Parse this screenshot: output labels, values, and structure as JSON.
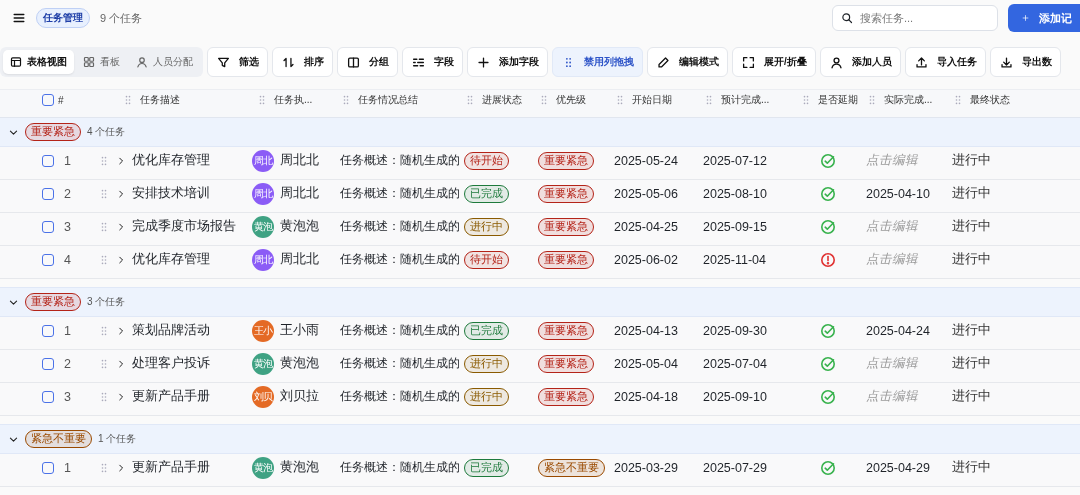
{
  "header": {
    "title_tag": "任务管理",
    "count": "9 个任务",
    "search": {
      "placeholder": "搜索任务..."
    },
    "add_button": "添加记"
  },
  "view_tabs": [
    {
      "label": "表格视图",
      "kind": "table",
      "selected": true
    },
    {
      "label": "看板",
      "kind": "grid",
      "selected": false
    },
    {
      "label": "人员分配",
      "kind": "user",
      "selected": false
    }
  ],
  "toolbar": [
    {
      "label": "筛选",
      "kind": "filter",
      "active": false
    },
    {
      "label": "排序",
      "kind": "sort",
      "active": false
    },
    {
      "label": "分组",
      "kind": "columns",
      "active": false
    },
    {
      "label": "字段",
      "kind": "fields",
      "active": false
    },
    {
      "label": "添加字段",
      "kind": "plus",
      "active": false
    },
    {
      "label": "禁用列拖拽",
      "kind": "grip",
      "active": true
    },
    {
      "label": "编辑模式",
      "kind": "pencil",
      "active": false
    },
    {
      "label": "展开/折叠",
      "kind": "expand",
      "active": false
    },
    {
      "label": "添加人员",
      "kind": "user",
      "active": false
    },
    {
      "label": "导入任务",
      "kind": "upload",
      "active": false
    },
    {
      "label": "导出数",
      "kind": "download",
      "active": false
    }
  ],
  "table": {
    "select_all": {
      "checked": false
    },
    "columns": [
      "#",
      "任务描述",
      "任务执...",
      "任务情况总结",
      "进展状态",
      "优先级",
      "开始日期",
      "预计完成...",
      "是否延期",
      "实际完成...",
      "最终状态"
    ],
    "groups": [
      {
        "tag": {
          "text": "重要紧急",
          "color": "#b42318"
        },
        "count": "4 个任务",
        "expanded": true,
        "rows": [
          {
            "checked": false,
            "number": "1",
            "title": "优化库存管理",
            "expanded": false,
            "assignee": {
              "initials": "周北",
              "name": "周北北",
              "color": "#8b5cf6"
            },
            "summary": "任务概述：随机生成的",
            "status": {
              "text": "待开始",
              "color": "#b42318"
            },
            "priority": {
              "text": "重要紧急",
              "color": "#b42318"
            },
            "start": "2025-05-24",
            "planned": "2025-07-12",
            "delayed": false,
            "actual": {
              "text": "点击编辑",
              "kind": "placeholder"
            },
            "final": "进行中"
          },
          {
            "checked": false,
            "number": "2",
            "title": "安排技术培训",
            "expanded": false,
            "assignee": {
              "initials": "周北",
              "name": "周北北",
              "color": "#8b5cf6"
            },
            "summary": "任务概述：随机生成的",
            "status": {
              "text": "已完成",
              "color": "#1e7a3c"
            },
            "priority": {
              "text": "重要紧急",
              "color": "#b42318"
            },
            "start": "2025-05-06",
            "planned": "2025-08-10",
            "delayed": false,
            "actual": {
              "text": "2025-04-10",
              "kind": "date"
            },
            "final": "进行中"
          },
          {
            "checked": false,
            "number": "3",
            "title": "完成季度市场报告",
            "expanded": false,
            "assignee": {
              "initials": "黄泡",
              "name": "黄泡泡",
              "color": "#3fa283"
            },
            "summary": "任务概述：随机生成的",
            "status": {
              "text": "进行中",
              "color": "#8a5a00"
            },
            "priority": {
              "text": "重要紧急",
              "color": "#b42318"
            },
            "start": "2025-04-25",
            "planned": "2025-09-15",
            "delayed": false,
            "actual": {
              "text": "点击编辑",
              "kind": "placeholder"
            },
            "final": "进行中"
          },
          {
            "checked": false,
            "number": "4",
            "title": "优化库存管理",
            "expanded": false,
            "assignee": {
              "initials": "周北",
              "name": "周北北",
              "color": "#8b5cf6"
            },
            "summary": "任务概述：随机生成的",
            "status": {
              "text": "待开始",
              "color": "#b42318"
            },
            "priority": {
              "text": "重要紧急",
              "color": "#b42318"
            },
            "start": "2025-06-02",
            "planned": "2025-11-04",
            "delayed": true,
            "actual": {
              "text": "点击编辑",
              "kind": "placeholder"
            },
            "final": "进行中"
          }
        ]
      },
      {
        "tag": {
          "text": "重要紧急",
          "color": "#b42318"
        },
        "count": "3 个任务",
        "expanded": true,
        "rows": [
          {
            "checked": false,
            "number": "1",
            "title": "策划品牌活动",
            "expanded": false,
            "assignee": {
              "initials": "王小",
              "name": "王小雨",
              "color": "#e46a25"
            },
            "summary": "任务概述：随机生成的",
            "status": {
              "text": "已完成",
              "color": "#1e7a3c"
            },
            "priority": {
              "text": "重要紧急",
              "color": "#b42318"
            },
            "start": "2025-04-13",
            "planned": "2025-09-30",
            "delayed": false,
            "actual": {
              "text": "2025-04-24",
              "kind": "date"
            },
            "final": "进行中"
          },
          {
            "checked": false,
            "number": "2",
            "title": "处理客户投诉",
            "expanded": false,
            "assignee": {
              "initials": "黄泡",
              "name": "黄泡泡",
              "color": "#3fa283"
            },
            "summary": "任务概述：随机生成的",
            "status": {
              "text": "进行中",
              "color": "#8a5a00"
            },
            "priority": {
              "text": "重要紧急",
              "color": "#b42318"
            },
            "start": "2025-05-04",
            "planned": "2025-07-04",
            "delayed": false,
            "actual": {
              "text": "点击编辑",
              "kind": "placeholder"
            },
            "final": "进行中"
          },
          {
            "checked": false,
            "number": "3",
            "title": "更新产品手册",
            "expanded": false,
            "assignee": {
              "initials": "刘贝",
              "name": "刘贝拉",
              "color": "#e46a25"
            },
            "summary": "任务概述：随机生成的",
            "status": {
              "text": "进行中",
              "color": "#8a5a00"
            },
            "priority": {
              "text": "重要紧急",
              "color": "#b42318"
            },
            "start": "2025-04-18",
            "planned": "2025-09-10",
            "delayed": false,
            "actual": {
              "text": "点击编辑",
              "kind": "placeholder"
            },
            "final": "进行中"
          }
        ]
      },
      {
        "tag": {
          "text": "紧急不重要",
          "color": "#9a4a00"
        },
        "count": "1 个任务",
        "expanded": true,
        "rows": [
          {
            "checked": false,
            "number": "1",
            "title": "更新产品手册",
            "expanded": false,
            "assignee": {
              "initials": "黄泡",
              "name": "黄泡泡",
              "color": "#3fa283"
            },
            "summary": "任务概述：随机生成的",
            "status": {
              "text": "已完成",
              "color": "#1e7a3c"
            },
            "priority": {
              "text": "紧急不重要",
              "color": "#9a4a00"
            },
            "start": "2025-03-29",
            "planned": "2025-07-29",
            "delayed": false,
            "actual": {
              "text": "2025-04-29",
              "kind": "date"
            },
            "final": "进行中"
          }
        ]
      }
    ]
  }
}
